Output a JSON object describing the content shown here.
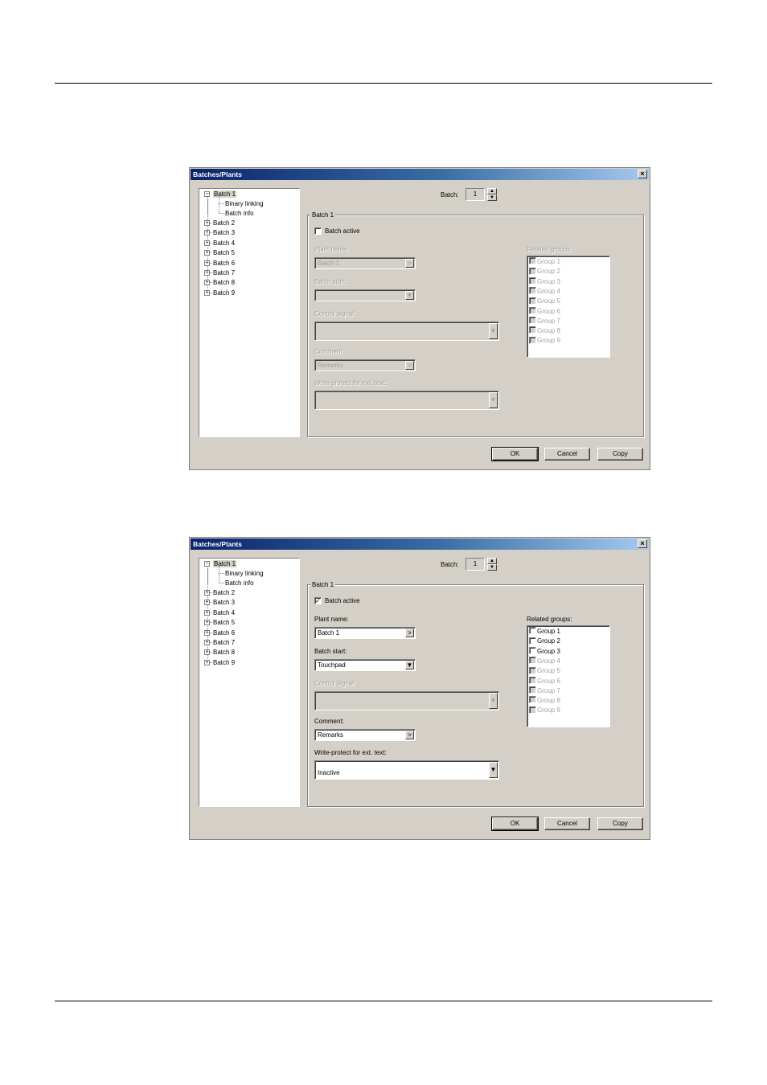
{
  "dialogs": [
    {
      "title": "Batches/Plants",
      "close_symbol": "×",
      "tree": {
        "expanded": {
          "label": "Batch 1",
          "children": [
            "Binary linking",
            "Batch info"
          ]
        },
        "collapsed": [
          "Batch 2",
          "Batch 3",
          "Batch 4",
          "Batch 5",
          "Batch 6",
          "Batch 7",
          "Batch 8",
          "Batch 9"
        ]
      },
      "spinner": {
        "label": "Batch:",
        "value": "1",
        "up": "▲",
        "down": "▼"
      },
      "group_title": "Batch 1",
      "batch_active": {
        "label": "Batch active",
        "checked": false,
        "mark": ""
      },
      "plant_name": {
        "label": "Plant name:",
        "value": "Batch 1",
        "button": ">"
      },
      "batch_start": {
        "label": "Batch start:",
        "value": "",
        "button": "▼"
      },
      "control_signal": {
        "label": "Control signal:",
        "value": "",
        "button": "▼"
      },
      "comment": {
        "label": "Comment:",
        "value": "Remarks",
        "button": ">"
      },
      "write_protect": {
        "label": "Write-protect for ext. text:",
        "value": "",
        "button": "▼"
      },
      "related_groups": {
        "label": "Related groups:",
        "items": [
          {
            "label": "Group 1",
            "enabled": false
          },
          {
            "label": "Group 2",
            "enabled": false
          },
          {
            "label": "Group 3",
            "enabled": false
          },
          {
            "label": "Group 4",
            "enabled": false
          },
          {
            "label": "Group 5",
            "enabled": false
          },
          {
            "label": "Group 6",
            "enabled": false
          },
          {
            "label": "Group 7",
            "enabled": false
          },
          {
            "label": "Group 8",
            "enabled": false
          },
          {
            "label": "Group 9",
            "enabled": false
          }
        ]
      },
      "buttons": {
        "ok": "OK",
        "cancel": "Cancel",
        "copy": "Copy"
      }
    },
    {
      "title": "Batches/Plants",
      "close_symbol": "×",
      "tree": {
        "expanded": {
          "label": "Batch 1",
          "children": [
            "Binary linking",
            "Batch info"
          ]
        },
        "collapsed": [
          "Batch 2",
          "Batch 3",
          "Batch 4",
          "Batch 5",
          "Batch 6",
          "Batch 7",
          "Batch 8",
          "Batch 9"
        ]
      },
      "spinner": {
        "label": "Batch:",
        "value": "1",
        "up": "▲",
        "down": "▼"
      },
      "group_title": "Batch 1",
      "batch_active": {
        "label": "Batch active",
        "checked": true,
        "mark": "✓"
      },
      "plant_name": {
        "label": "Plant name:",
        "value": "Batch 1",
        "button": ">"
      },
      "batch_start": {
        "label": "Batch start:",
        "value": "Touchpad",
        "button": "▼"
      },
      "control_signal": {
        "label": "Control signal:",
        "value": "",
        "button": "▼"
      },
      "comment": {
        "label": "Comment:",
        "value": "Remarks",
        "button": ">"
      },
      "write_protect": {
        "label": "Write-protect for ext. text:",
        "value": "Inactive",
        "button": "▼"
      },
      "related_groups": {
        "label": "Related groups:",
        "items": [
          {
            "label": "Group 1",
            "enabled": true
          },
          {
            "label": "Group 2",
            "enabled": true
          },
          {
            "label": "Group 3",
            "enabled": true
          },
          {
            "label": "Group 4",
            "enabled": false
          },
          {
            "label": "Group 5",
            "enabled": false
          },
          {
            "label": "Group 6",
            "enabled": false
          },
          {
            "label": "Group 7",
            "enabled": false
          },
          {
            "label": "Group 8",
            "enabled": false
          },
          {
            "label": "Group 9",
            "enabled": false
          }
        ]
      },
      "buttons": {
        "ok": "OK",
        "cancel": "Cancel",
        "copy": "Copy"
      }
    }
  ]
}
